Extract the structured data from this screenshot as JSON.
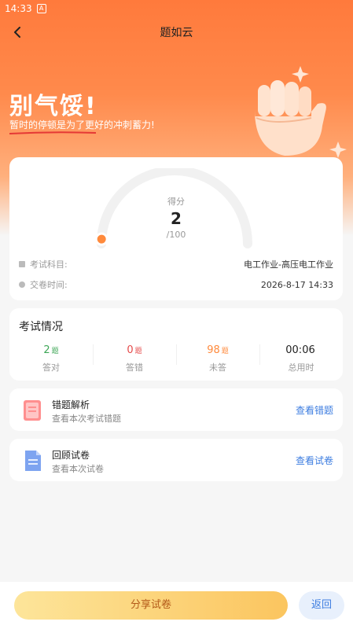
{
  "status_bar": {
    "time": "14:33",
    "indicator": "A"
  },
  "header": {
    "title": "题如云"
  },
  "banner": {
    "headline": "别气馁!",
    "subline": "暂时的停顿是为了更好的冲刺蓄力!"
  },
  "score": {
    "label": "得分",
    "value": "2",
    "total": "/100",
    "fraction": 0.02
  },
  "info": {
    "subject_label": "考试科目:",
    "subject_value": "电工作业-高压电工作业",
    "time_label": "交卷时间:",
    "time_value": "2026-8-17 14:33"
  },
  "exam": {
    "title": "考试情况",
    "stats": [
      {
        "value": "2",
        "unit": "题",
        "caption": "答对",
        "color": "#3ca655"
      },
      {
        "value": "0",
        "unit": "题",
        "caption": "答错",
        "color": "#e54b4b"
      },
      {
        "value": "98",
        "unit": "题",
        "caption": "未答",
        "color": "#ff8a3c"
      },
      {
        "value": "00:06",
        "unit": "",
        "caption": "总用时",
        "color": "#222222"
      }
    ]
  },
  "actions": [
    {
      "title": "错题解析",
      "desc": "查看本次考试错题",
      "link": "查看错题",
      "icon": "wrong-questions-icon"
    },
    {
      "title": "回顾试卷",
      "desc": "查看本次试卷",
      "link": "查看试卷",
      "icon": "review-paper-icon"
    }
  ],
  "bottom": {
    "share": "分享试卷",
    "back": "返回"
  },
  "colors": {
    "accent": "#ff7a3c",
    "link": "#3d7de0"
  }
}
